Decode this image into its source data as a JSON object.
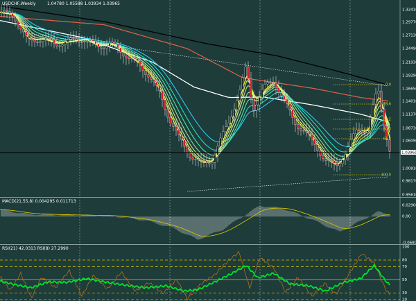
{
  "window": {
    "title": "USDCHF,Weekly",
    "ohlc": "1.04780 1.05588 1.03934 1.03965"
  },
  "colors": {
    "background": "#1d3c3a",
    "grid": "#d8e4e2",
    "bull_candle": "#1e2a2a",
    "bear_candle": "#d02030",
    "ma_slow": "#000000",
    "ma_red": "#d6604a",
    "ma_white": "#ffffff",
    "ribbon_fast": [
      "#ffff30",
      "#e8f060",
      "#c8e880",
      "#98e8a0",
      "#60e8b0",
      "#20e8c8",
      "#30d0ff"
    ],
    "fib": "#e6d200",
    "macd_hist": "#e8e8e8",
    "macd_signal": "#d2c000",
    "rsi_fast": "#00e030",
    "rsi_slow": "#b87018",
    "rsi_levels": "#d8c800"
  },
  "price_axis": {
    "labels": [
      "1.32410",
      "1.29770",
      "1.27130",
      "1.24490",
      "1.21930",
      "1.19290",
      "1.16650",
      "1.14010",
      "1.11370",
      "1.08730",
      "1.06090",
      "1.03965",
      "1.00810",
      "0.98170",
      "0.95610"
    ],
    "current": "1.03965"
  },
  "fib_levels": [
    "0.0",
    "23.6",
    "38.2",
    "50.0",
    "61.8",
    "100.0"
  ],
  "macd": {
    "title": "MACD(21,55,8) 0.004295 0.011713",
    "axis": [
      "0.02908",
      "0.00",
      "-0.06809"
    ]
  },
  "rsi": {
    "title": "RSI(21) 42.0313  RSI(8) 27.2990",
    "axis": [
      "100",
      "80",
      "70",
      "50",
      "30",
      "20"
    ]
  },
  "chart_data": {
    "type": "line",
    "symbol": "USDCHF",
    "timeframe": "Weekly",
    "ylim": [
      0.9561,
      1.3241
    ],
    "price_path": [
      [
        0,
        1.305
      ],
      [
        20,
        1.3
      ],
      [
        40,
        1.25
      ],
      [
        60,
        1.255
      ],
      [
        80,
        1.245
      ],
      [
        100,
        1.25
      ],
      [
        120,
        1.255
      ],
      [
        140,
        1.24
      ],
      [
        160,
        1.245
      ],
      [
        180,
        1.225
      ],
      [
        200,
        1.205
      ],
      [
        215,
        1.185
      ],
      [
        230,
        1.15
      ],
      [
        245,
        1.1
      ],
      [
        260,
        1.06
      ],
      [
        275,
        1.03
      ],
      [
        290,
        1.015
      ],
      [
        305,
        1.02
      ],
      [
        315,
        1.05
      ],
      [
        330,
        1.095
      ],
      [
        345,
        1.15
      ],
      [
        355,
        1.2
      ],
      [
        365,
        1.12
      ],
      [
        380,
        1.16
      ],
      [
        395,
        1.175
      ],
      [
        410,
        1.135
      ],
      [
        425,
        1.095
      ],
      [
        440,
        1.075
      ],
      [
        455,
        1.05
      ],
      [
        470,
        1.02
      ],
      [
        485,
        1.01
      ],
      [
        500,
        1.04
      ],
      [
        515,
        1.08
      ],
      [
        530,
        1.08
      ],
      [
        545,
        1.16
      ],
      [
        555,
        1.085
      ],
      [
        562,
        1.04
      ]
    ],
    "moving_averages": [
      {
        "color": "#000000",
        "points": [
          [
            0,
            1.318
          ],
          [
            150,
            1.288
          ],
          [
            300,
            1.245
          ],
          [
            400,
            1.222
          ],
          [
            480,
            1.195
          ],
          [
            560,
            1.166
          ]
        ]
      },
      {
        "color": "#d6604a",
        "points": [
          [
            0,
            1.298
          ],
          [
            150,
            1.282
          ],
          [
            270,
            1.236
          ],
          [
            350,
            1.18
          ],
          [
            450,
            1.16
          ],
          [
            520,
            1.142
          ],
          [
            560,
            1.135
          ]
        ]
      },
      {
        "color": "#ffffff",
        "points": [
          [
            0,
            1.29
          ],
          [
            120,
            1.257
          ],
          [
            220,
            1.21
          ],
          [
            280,
            1.162
          ],
          [
            330,
            1.142
          ],
          [
            380,
            1.143
          ],
          [
            450,
            1.128
          ],
          [
            520,
            1.11
          ],
          [
            560,
            1.095
          ]
        ]
      }
    ],
    "macd_path": [
      [
        0,
        0.018
      ],
      [
        40,
        0.006
      ],
      [
        100,
        0.004
      ],
      [
        160,
        0.002
      ],
      [
        210,
        -0.01
      ],
      [
        250,
        -0.03
      ],
      [
        285,
        -0.06
      ],
      [
        320,
        -0.035
      ],
      [
        350,
        0.0
      ],
      [
        375,
        0.028
      ],
      [
        410,
        0.02
      ],
      [
        450,
        -0.008
      ],
      [
        490,
        -0.04
      ],
      [
        520,
        -0.012
      ],
      [
        545,
        0.012
      ],
      [
        560,
        0.006
      ]
    ],
    "rsi_fast_path": [
      [
        0,
        48
      ],
      [
        25,
        42
      ],
      [
        45,
        38
      ],
      [
        70,
        47
      ],
      [
        95,
        46
      ],
      [
        125,
        52
      ],
      [
        150,
        47
      ],
      [
        180,
        42
      ],
      [
        210,
        38
      ],
      [
        240,
        41
      ],
      [
        265,
        33
      ],
      [
        285,
        35
      ],
      [
        310,
        47
      ],
      [
        335,
        60
      ],
      [
        355,
        72
      ],
      [
        372,
        53
      ],
      [
        395,
        60
      ],
      [
        418,
        44
      ],
      [
        445,
        41
      ],
      [
        470,
        33
      ],
      [
        495,
        46
      ],
      [
        520,
        52
      ],
      [
        540,
        72
      ],
      [
        555,
        50
      ],
      [
        562,
        42
      ]
    ],
    "rsi_slow_path": [
      [
        0,
        55
      ],
      [
        15,
        34
      ],
      [
        30,
        60
      ],
      [
        45,
        22
      ],
      [
        60,
        54
      ],
      [
        80,
        38
      ],
      [
        100,
        64
      ],
      [
        118,
        26
      ],
      [
        135,
        57
      ],
      [
        155,
        36
      ],
      [
        175,
        62
      ],
      [
        195,
        33
      ],
      [
        215,
        46
      ],
      [
        235,
        29
      ],
      [
        255,
        51
      ],
      [
        270,
        21
      ],
      [
        290,
        44
      ],
      [
        310,
        58
      ],
      [
        330,
        80
      ],
      [
        345,
        92
      ],
      [
        360,
        38
      ],
      [
        375,
        84
      ],
      [
        395,
        68
      ],
      [
        412,
        31
      ],
      [
        430,
        54
      ],
      [
        450,
        25
      ],
      [
        468,
        45
      ],
      [
        485,
        28
      ],
      [
        505,
        62
      ],
      [
        522,
        90
      ],
      [
        540,
        75
      ],
      [
        555,
        38
      ],
      [
        562,
        27
      ]
    ]
  }
}
